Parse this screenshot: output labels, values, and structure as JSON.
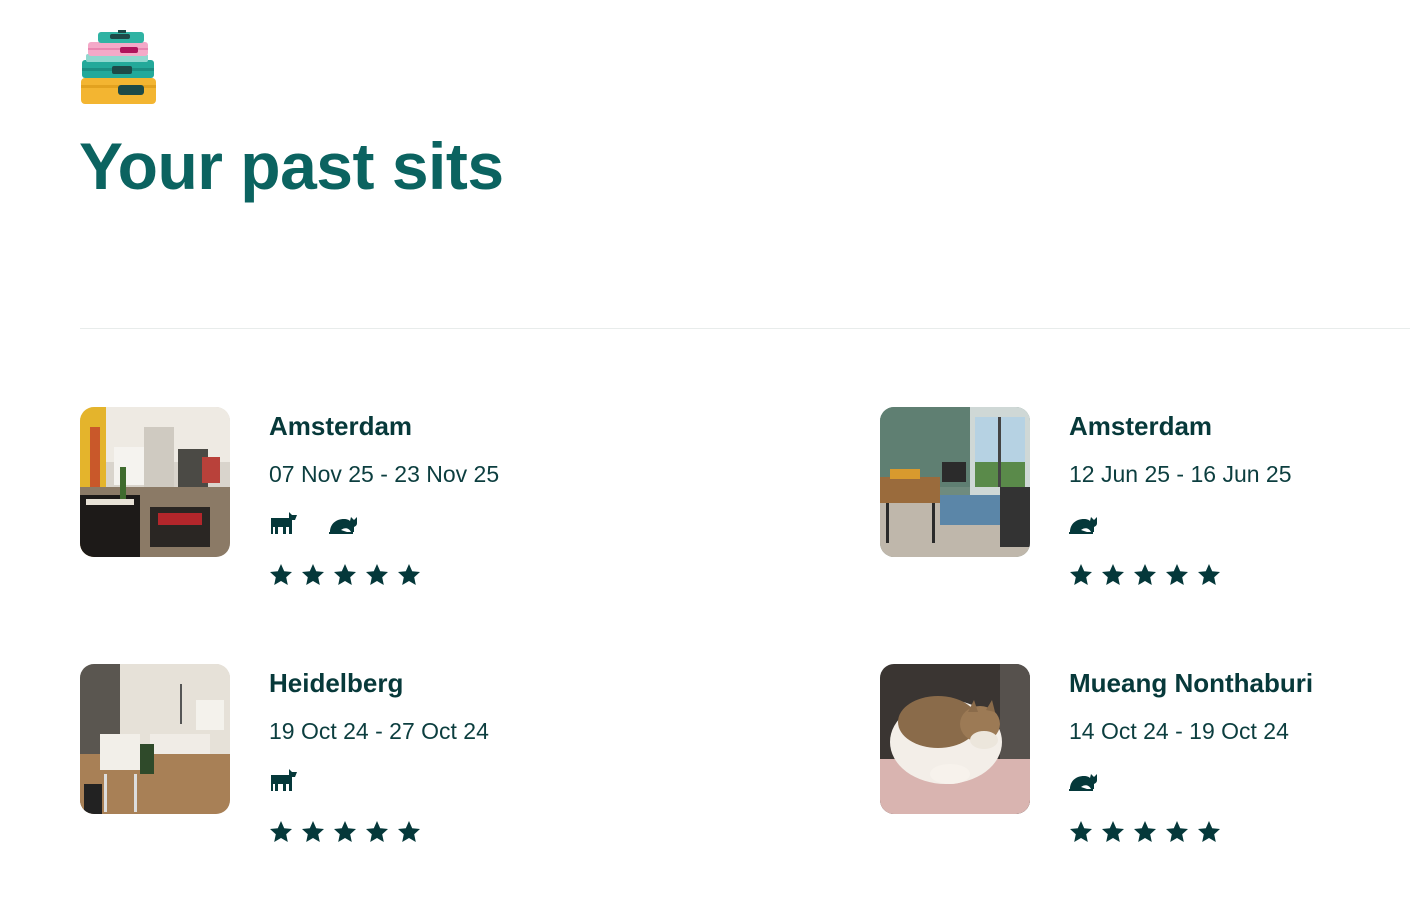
{
  "page": {
    "title": "Your past sits"
  },
  "colors": {
    "title": "#0b6360",
    "text": "#07393a",
    "divider": "#e8eceb",
    "icon": "#05383a"
  },
  "logo": {
    "icon": "stacked-suitcases-icon"
  },
  "sits": [
    {
      "city": "Amsterdam",
      "dates": "07 Nov 25 - 23 Nov 25",
      "pets": [
        "dog",
        "cat"
      ],
      "rating": 5,
      "photo": "living room with piano"
    },
    {
      "city": "Amsterdam",
      "dates": "12 Jun 25 - 16 Jun 25",
      "pets": [
        "cat"
      ],
      "rating": 5,
      "photo": "living room with dining table"
    },
    {
      "city": "Heidelberg",
      "dates": "19 Oct 24 - 27 Oct 24",
      "pets": [
        "dog"
      ],
      "rating": 5,
      "photo": "bedroom with desk"
    },
    {
      "city": "Mueang Nonthaburi",
      "dates": "14 Oct 24 - 19 Oct 24",
      "pets": [
        "cat"
      ],
      "rating": 5,
      "photo": "sleeping tabby cat"
    }
  ]
}
